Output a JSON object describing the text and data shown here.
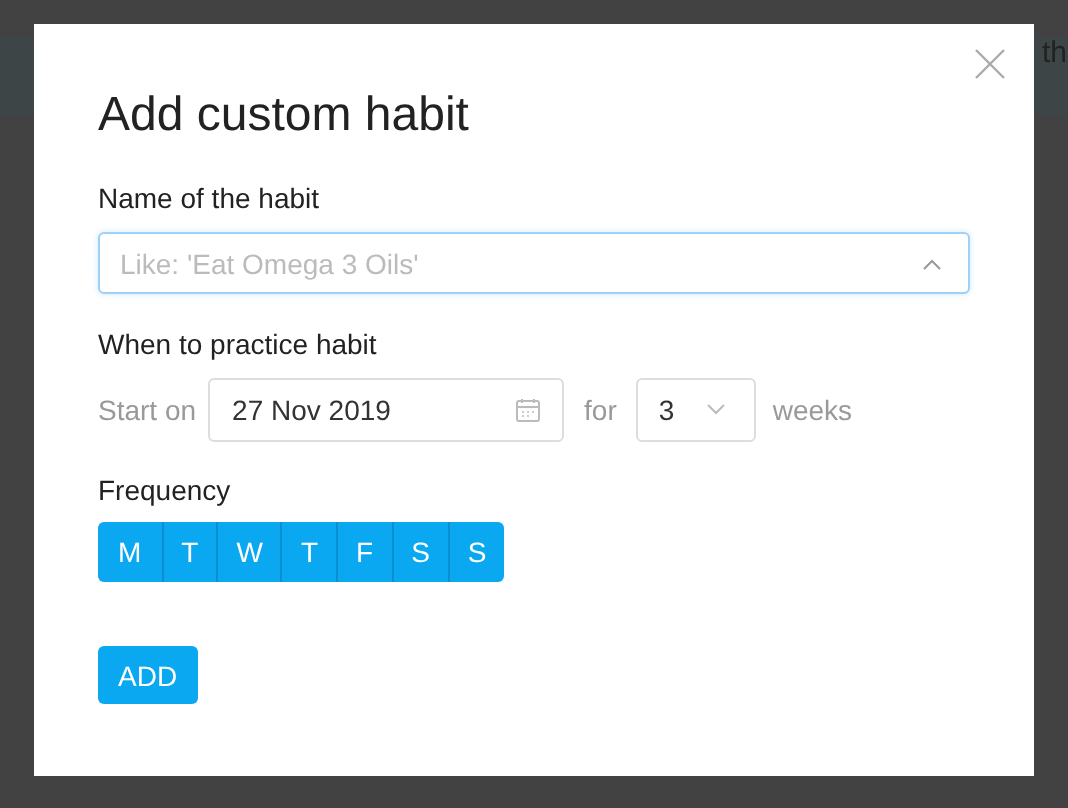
{
  "background": {
    "text": "th"
  },
  "dialog": {
    "title": "Add custom habit",
    "name_field": {
      "label": "Name of the habit",
      "placeholder": "Like: 'Eat Omega 3 Oils'"
    },
    "schedule": {
      "label": "When to practice habit",
      "start_label": "Start on",
      "date": "27 Nov 2019",
      "for_label": "for",
      "weeks": "3",
      "weeks_label": "weeks"
    },
    "frequency": {
      "label": "Frequency",
      "days": [
        {
          "label": "M",
          "selected": true
        },
        {
          "label": "T",
          "selected": true
        },
        {
          "label": "W",
          "selected": true
        },
        {
          "label": "T",
          "selected": true
        },
        {
          "label": "F",
          "selected": true
        },
        {
          "label": "S",
          "selected": true
        },
        {
          "label": "S",
          "selected": true
        }
      ]
    },
    "add_button": "ADD"
  }
}
